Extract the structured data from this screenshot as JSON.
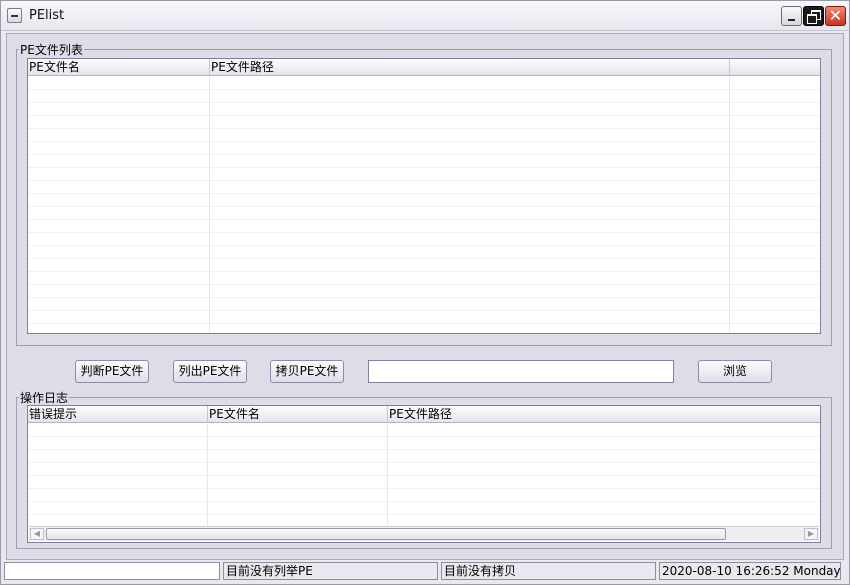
{
  "window": {
    "title": "PElist"
  },
  "pe_list_group": {
    "legend": "PE文件列表",
    "columns": [
      "PE文件名",
      "PE文件路径",
      ""
    ]
  },
  "buttons": {
    "judge_label": "判断PE文件",
    "list_label": "列出PE文件",
    "copy_label": "拷贝PE文件",
    "browse_label": "浏览"
  },
  "path_input": {
    "value": ""
  },
  "log_group": {
    "legend": "操作日志",
    "columns": [
      "错误提示",
      "PE文件名",
      "PE文件路径"
    ]
  },
  "statusbar": {
    "pane1": "",
    "pane2": "目前没有列举PE",
    "pane3": "目前没有拷贝",
    "pane4": "2020-08-10 16:26:52 Monday"
  }
}
